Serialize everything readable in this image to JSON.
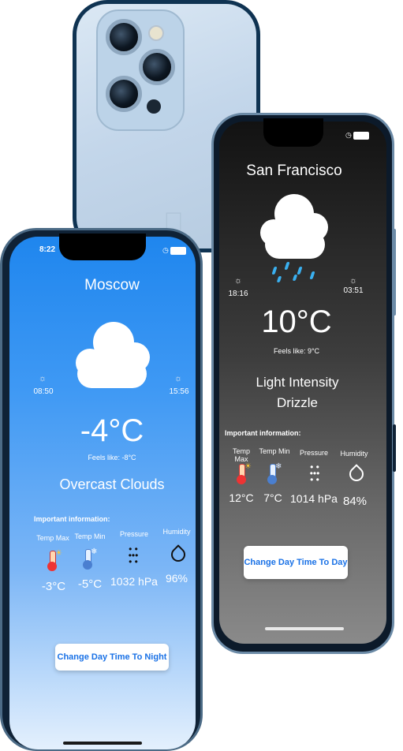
{
  "night_phone": {
    "city": "San Francisco",
    "sunrise": "18:16",
    "sunset": "03:51",
    "temperature": "10°C",
    "feels_like": "Feels like: 9°C",
    "description": "Light Intensity Drizzle",
    "important_label": "Important information:",
    "columns": [
      {
        "label": "Temp Max",
        "value": "12°C",
        "icon": "thermometer-hot-icon"
      },
      {
        "label": "Temp Min",
        "value": "7°C",
        "icon": "thermometer-cold-icon"
      },
      {
        "label": "Pressure",
        "value": "1014 hPa",
        "icon": "pressure-icon"
      },
      {
        "label": "Humidity",
        "value": "84%",
        "icon": "humidity-drop-icon"
      }
    ],
    "button_label": "Change Day Time To Day"
  },
  "day_phone": {
    "status_time": "8:22",
    "city": "Moscow",
    "sunrise": "08:50",
    "sunset": "15:56",
    "temperature": "-4°C",
    "feels_like": "Feels like: -8°C",
    "description": "Overcast Clouds",
    "important_label": "Important information:",
    "columns": [
      {
        "label": "Temp Max",
        "value": "-3°C",
        "icon": "thermometer-hot-icon"
      },
      {
        "label": "Temp Min",
        "value": "-5°C",
        "icon": "thermometer-cold-icon"
      },
      {
        "label": "Pressure",
        "value": "1032 hPa",
        "icon": "pressure-icon"
      },
      {
        "label": "Humidity",
        "value": "96%",
        "icon": "humidity-drop-icon"
      }
    ],
    "button_label": "Change Day Time To Night"
  },
  "colors": {
    "day_gradient_top": "#1f86ee",
    "day_gradient_bottom": "#e4f0fd",
    "night_gradient_top": "#121212",
    "night_gradient_bottom": "#8a8a8a",
    "button_text": "#1971e6",
    "rain": "#3ab0f0"
  }
}
